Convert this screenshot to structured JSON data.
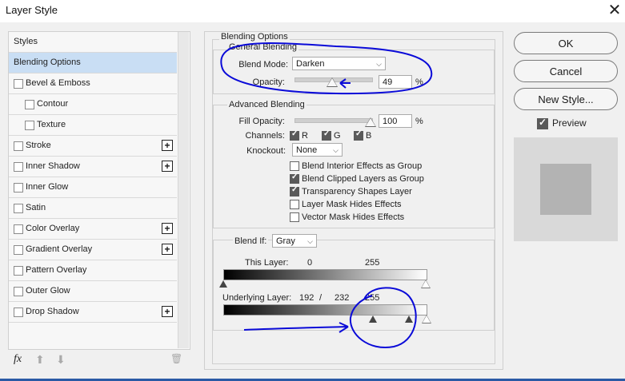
{
  "window": {
    "title": "Layer Style",
    "close_glyph": "✕"
  },
  "styles_list": {
    "header": "Styles",
    "items": [
      {
        "label": "Blending Options",
        "checkbox": false,
        "plus": false,
        "selected": true,
        "indent": 0
      },
      {
        "label": "Bevel & Emboss",
        "checkbox": true,
        "plus": false,
        "selected": false,
        "indent": 0
      },
      {
        "label": "Contour",
        "checkbox": true,
        "plus": false,
        "selected": false,
        "indent": 1
      },
      {
        "label": "Texture",
        "checkbox": true,
        "plus": false,
        "selected": false,
        "indent": 1
      },
      {
        "label": "Stroke",
        "checkbox": true,
        "plus": true,
        "selected": false,
        "indent": 0
      },
      {
        "label": "Inner Shadow",
        "checkbox": true,
        "plus": true,
        "selected": false,
        "indent": 0
      },
      {
        "label": "Inner Glow",
        "checkbox": true,
        "plus": false,
        "selected": false,
        "indent": 0
      },
      {
        "label": "Satin",
        "checkbox": true,
        "plus": false,
        "selected": false,
        "indent": 0
      },
      {
        "label": "Color Overlay",
        "checkbox": true,
        "plus": true,
        "selected": false,
        "indent": 0
      },
      {
        "label": "Gradient Overlay",
        "checkbox": true,
        "plus": true,
        "selected": false,
        "indent": 0
      },
      {
        "label": "Pattern Overlay",
        "checkbox": true,
        "plus": false,
        "selected": false,
        "indent": 0
      },
      {
        "label": "Outer Glow",
        "checkbox": true,
        "plus": false,
        "selected": false,
        "indent": 0
      },
      {
        "label": "Drop Shadow",
        "checkbox": true,
        "plus": true,
        "selected": false,
        "indent": 0
      }
    ],
    "tools": {
      "fx": "fx",
      "up": "⬆",
      "down": "⬇",
      "trash": "🗑"
    }
  },
  "blending_options": {
    "title": "Blending Options",
    "general": {
      "title": "General Blending",
      "blend_mode_label": "Blend Mode:",
      "blend_mode_value": "Darken",
      "opacity_label": "Opacity:",
      "opacity_value": "49",
      "opacity_unit": "%",
      "opacity_fraction": 0.49
    },
    "advanced": {
      "title": "Advanced Blending",
      "fill_opacity_label": "Fill Opacity:",
      "fill_opacity_value": "100",
      "fill_opacity_unit": "%",
      "channels_label": "Channels:",
      "channels": [
        {
          "label": "R",
          "checked": true
        },
        {
          "label": "G",
          "checked": true
        },
        {
          "label": "B",
          "checked": true
        }
      ],
      "knockout_label": "Knockout:",
      "knockout_value": "None",
      "options": [
        {
          "label": "Blend Interior Effects as Group",
          "checked": false
        },
        {
          "label": "Blend Clipped Layers as Group",
          "checked": true
        },
        {
          "label": "Transparency Shapes Layer",
          "checked": true
        },
        {
          "label": "Layer Mask Hides Effects",
          "checked": false
        },
        {
          "label": "Vector Mask Hides Effects",
          "checked": false
        }
      ]
    },
    "blend_if": {
      "label": "Blend If:",
      "value": "Gray",
      "this_layer_label": "This Layer:",
      "this_layer_low": "0",
      "this_layer_high": "255",
      "underlying_label": "Underlying Layer:",
      "underlying_low": "192",
      "underlying_sep": "/",
      "underlying_mid": "232",
      "underlying_high": "255"
    }
  },
  "buttons": {
    "ok": "OK",
    "cancel": "Cancel",
    "new_style": "New Style..."
  },
  "preview": {
    "label": "Preview",
    "checked": true
  },
  "colors": {
    "selection": "#c9def4",
    "annotation": "#0a0ad8",
    "taskbar": "#2a5aa5"
  }
}
